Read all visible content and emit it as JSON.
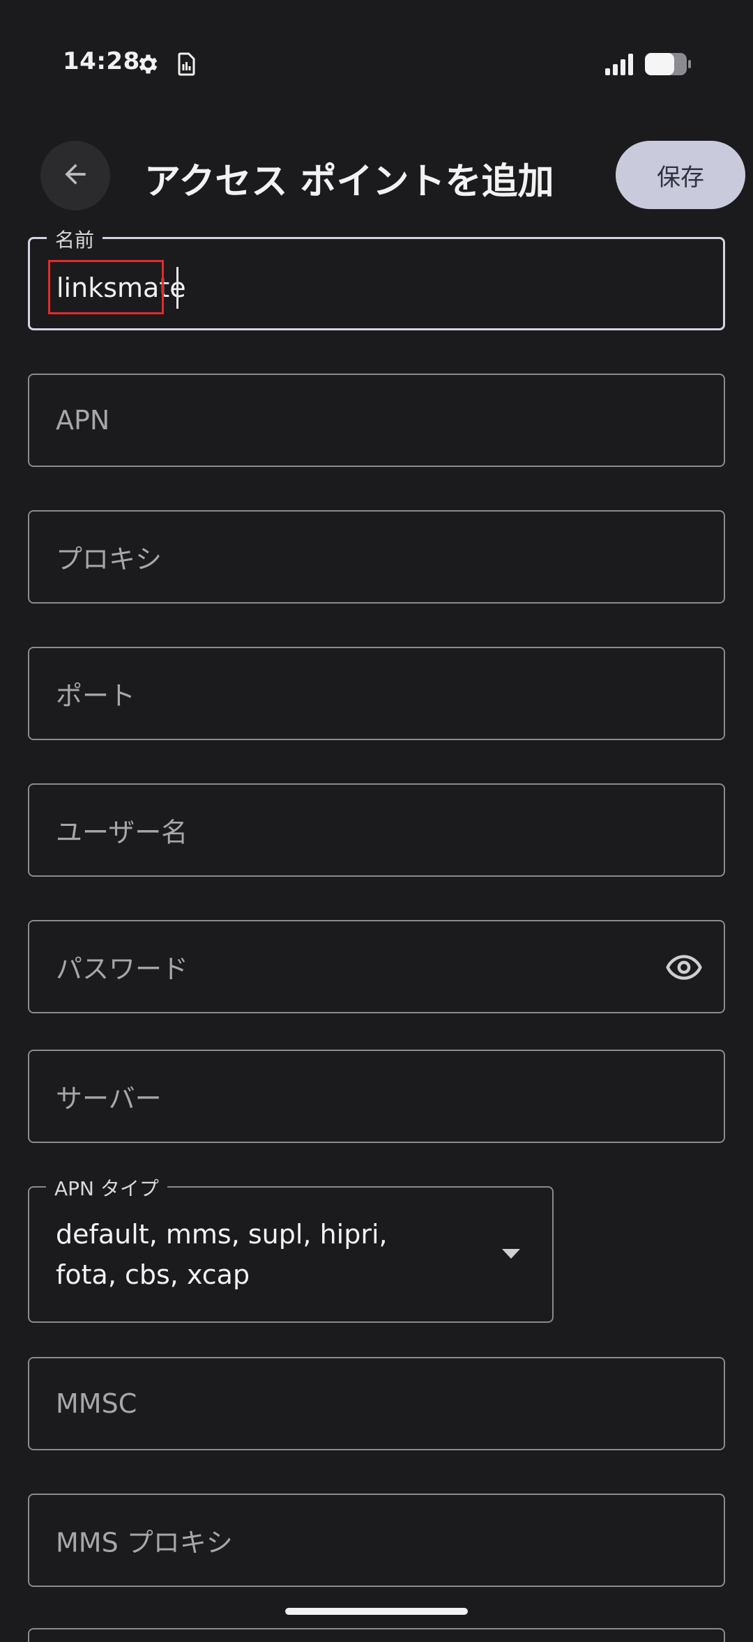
{
  "status_bar": {
    "time": "14:28",
    "icons": [
      "gear-icon",
      "sim-card-icon",
      "signal-icon",
      "battery-icon"
    ]
  },
  "app_bar": {
    "title": "アクセス ポイントを追加",
    "save_label": "保存",
    "back_icon": "arrow-left-icon"
  },
  "form": {
    "name": {
      "label": "名前",
      "value": "linksmate"
    },
    "apn": {
      "placeholder": "APN"
    },
    "proxy": {
      "placeholder": "プロキシ"
    },
    "port": {
      "placeholder": "ポート"
    },
    "username": {
      "placeholder": "ユーザー名"
    },
    "password": {
      "placeholder": "パスワード",
      "icon": "eye-icon"
    },
    "server": {
      "placeholder": "サーバー"
    },
    "apn_type": {
      "label": "APN タイプ",
      "value": "default, mms, supl, hipri, fota, cbs, xcap"
    },
    "mmsc": {
      "placeholder": "MMSC"
    },
    "mms_proxy": {
      "placeholder": "MMS プロキシ"
    }
  },
  "colors": {
    "background": "#1b1b1d",
    "save_button_bg": "#c9cbdc",
    "highlight": "#e32a2a"
  }
}
